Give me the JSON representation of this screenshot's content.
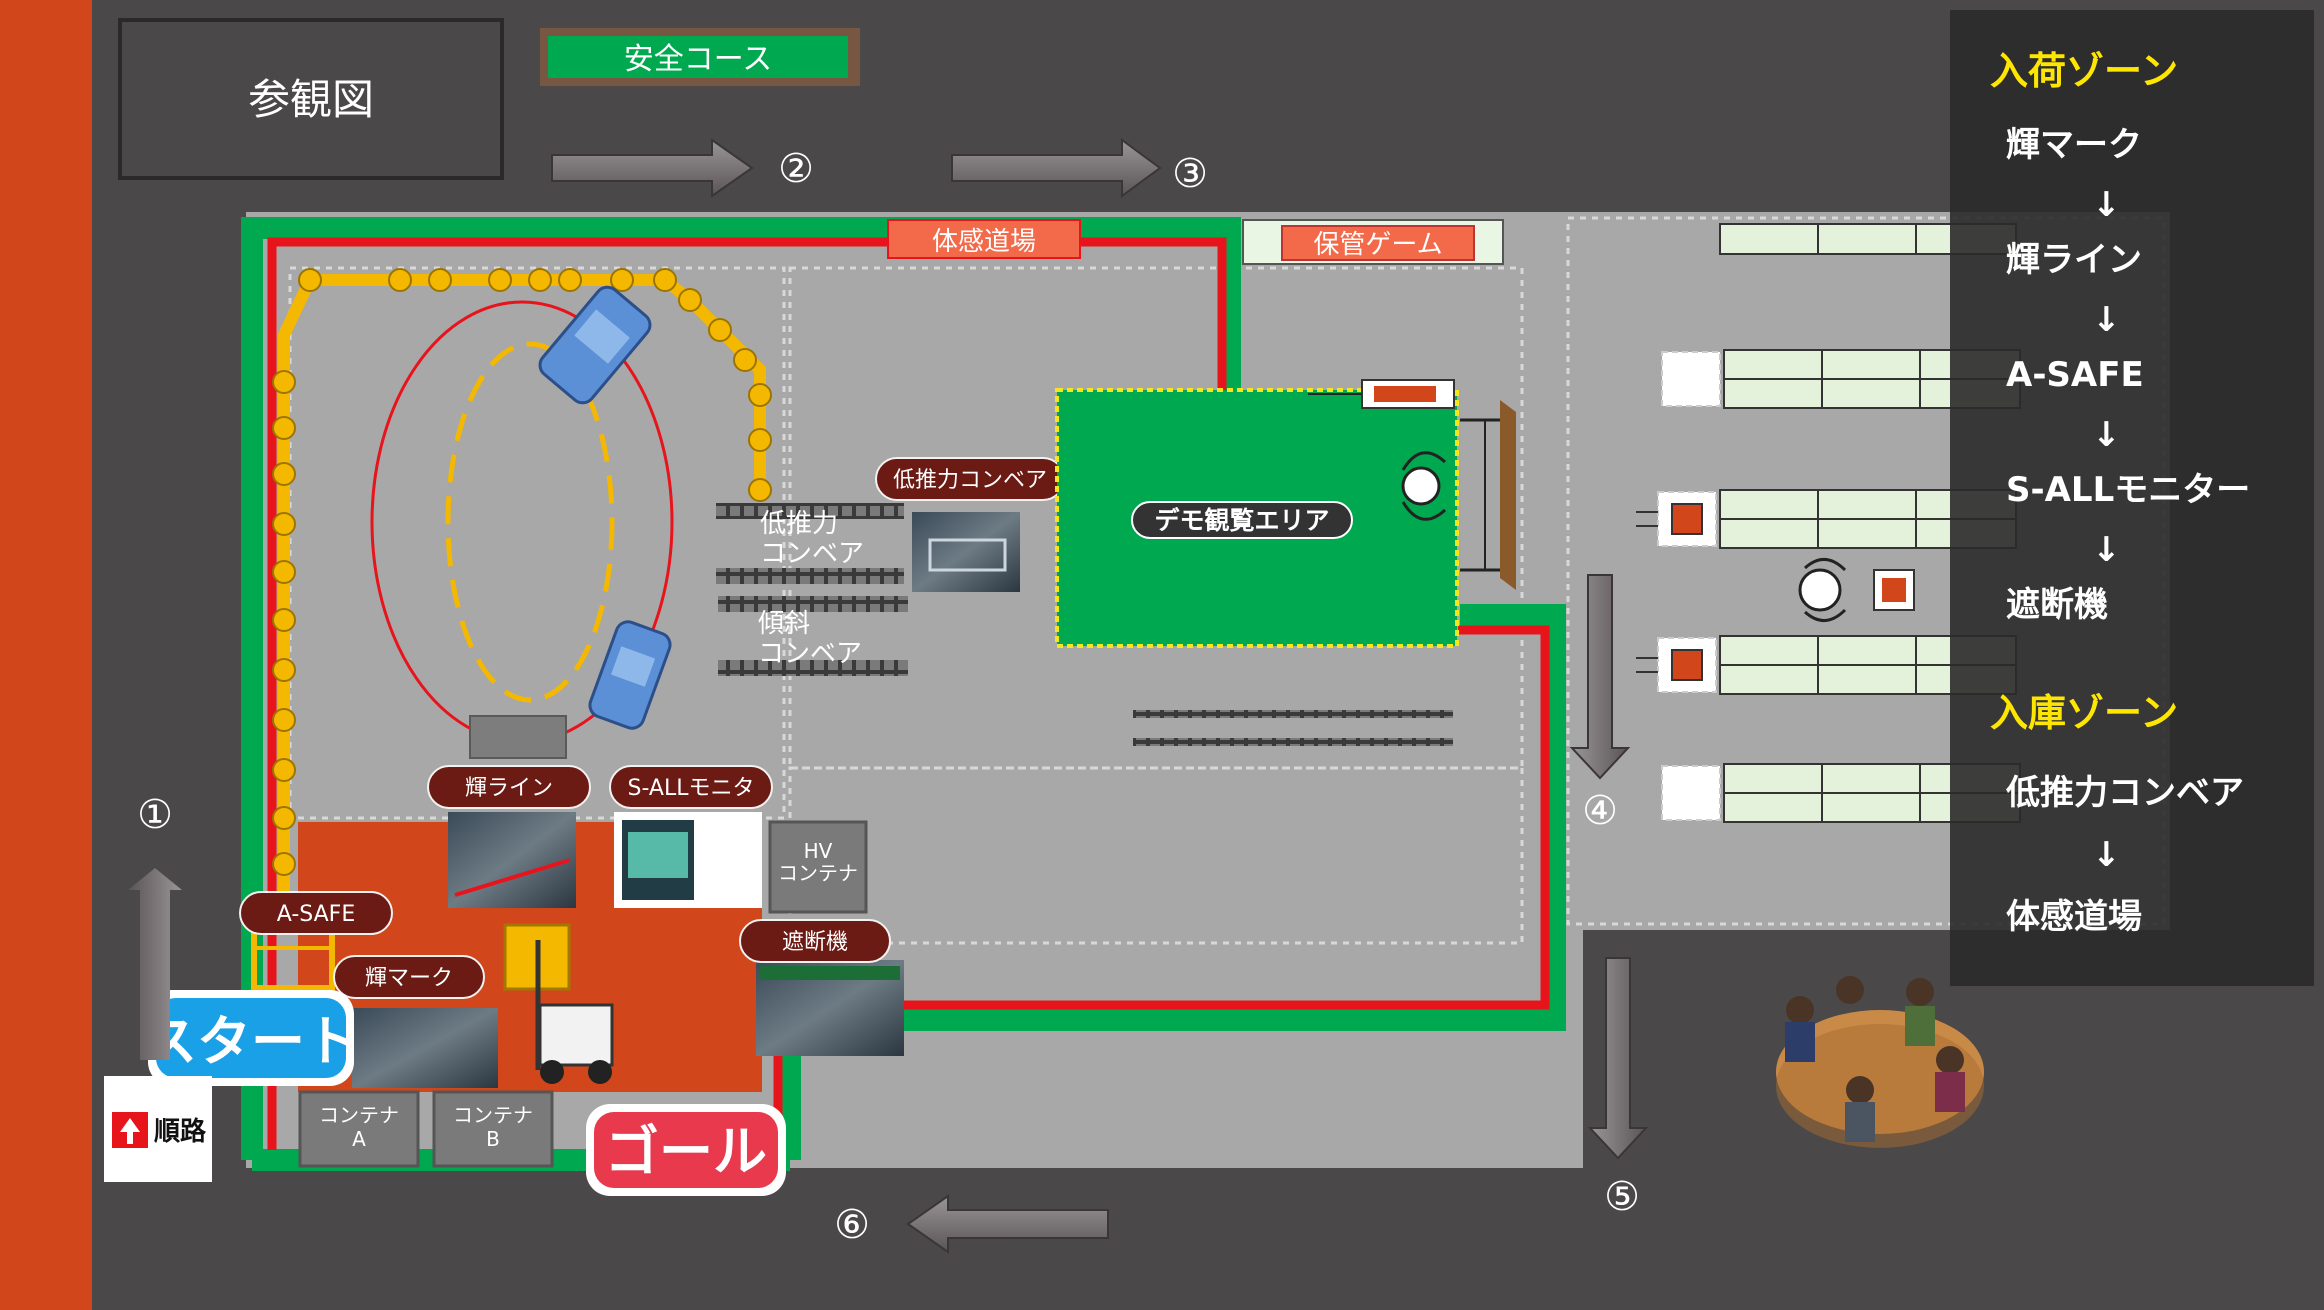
{
  "title": "参観図",
  "course_label": "安全コース",
  "steps": [
    "①",
    "②",
    "③",
    "④",
    "⑤",
    "⑥"
  ],
  "places": {
    "taikan": "体感道場",
    "hokan": "保管ゲーム",
    "demo": "デモ観覧エリア",
    "lowforce_tag": "低推力コンベア",
    "lowforce_a": "低推力",
    "lowforce_b": "コンベア",
    "incline_a": "傾斜",
    "incline_b": "コンベア",
    "hv_a": "HV",
    "hv_b": "コンテナ",
    "container_a_1": "コンテナ",
    "container_a_2": "A",
    "container_b_1": "コンテナ",
    "container_b_2": "B"
  },
  "tags": {
    "kiline": "輝ライン",
    "sall": "S-ALLモニタ",
    "asafe": "A-SAFE",
    "kimark": "輝マーク",
    "shadan": "遮断機"
  },
  "start_label": "スタート",
  "goal_label": "ゴール",
  "route_sign": "順路",
  "zones": {
    "arrival_title": "入荷ゾーン",
    "arrival_items": [
      "輝マーク",
      "輝ライン",
      "A-SAFE",
      "S-ALLモニター",
      "遮断機"
    ],
    "storage_title": "入庫ゾーン",
    "storage_items": [
      "低推力コンベア",
      "体感道場"
    ],
    "arrow": "↓"
  },
  "colors": {
    "background": "#4a4848",
    "floor": "#a8a8a8",
    "green": "#00a94f",
    "red": "#e8141c",
    "yellow": "#f5b800",
    "orange": "#d2461b",
    "tag_fill": "#6b1a14",
    "zone_title": "#ffe600"
  }
}
